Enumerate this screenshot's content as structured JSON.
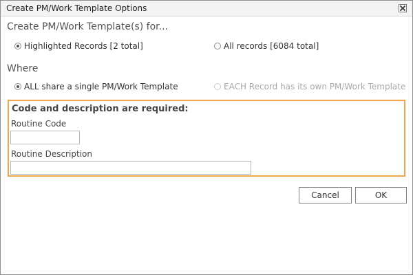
{
  "window": {
    "title": "Create PM/Work Template Options"
  },
  "section_for": {
    "heading": "Create PM/Work Template(s) for...",
    "options": [
      {
        "label": "Highlighted Records [2 total]",
        "checked": true,
        "disabled": false
      },
      {
        "label": "All records [6084 total]",
        "checked": false,
        "disabled": false
      }
    ]
  },
  "section_where": {
    "heading": "Where",
    "options": [
      {
        "label": "ALL share a single PM/Work Template",
        "checked": true,
        "disabled": false
      },
      {
        "label": "EACH Record has its own PM/Work Template",
        "checked": false,
        "disabled": true
      }
    ]
  },
  "required": {
    "title": "Code and description are required:",
    "routine_code_label": "Routine Code",
    "routine_code_value": "",
    "routine_description_label": "Routine Description",
    "routine_description_value": ""
  },
  "buttons": {
    "cancel": "Cancel",
    "ok": "OK"
  },
  "colors": {
    "highlight_border": "#f5a64a",
    "heading_text": "#555555",
    "disabled_text": "#a8a8a8"
  }
}
